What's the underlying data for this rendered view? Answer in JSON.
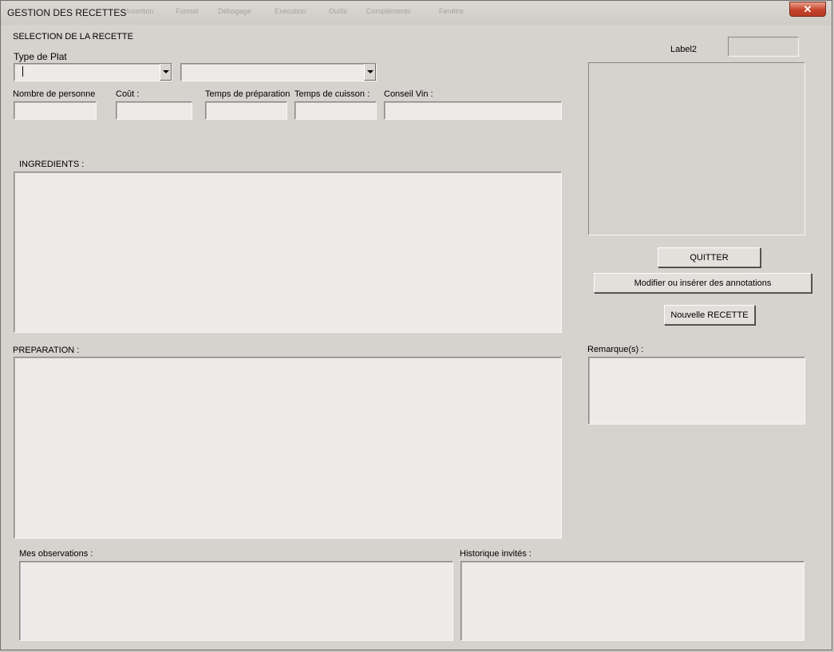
{
  "window": {
    "title": "GESTION DES RECETTES",
    "close_glyph": "✕"
  },
  "menu_ghost": [
    "Insertion",
    "Format",
    "Débogage",
    "Exécution",
    "Outils",
    "Compléments",
    "Fenêtre"
  ],
  "form": {
    "section_label": "SELECTION DE LA RECETTE",
    "type_plat_label": "Type de Plat",
    "type_plat_value": "",
    "recette_value": "",
    "nb_personne_label": "Nombre de personne",
    "cout_label": "Coût :",
    "temps_prep_label": "Temps de préparation",
    "temps_cuisson_label": "Temps de cuisson :",
    "conseil_vin_label": "Conseil Vin :",
    "nb_personne_value": "",
    "cout_value": "",
    "temps_prep_value": "",
    "temps_cuisson_value": "",
    "conseil_vin_value": "",
    "ingredients_label": "INGREDIENTS :",
    "preparation_label": "PREPARATION :",
    "remarques_label": "Remarque(s) :",
    "observations_label": "Mes observations :",
    "historique_label": "Historique invités :",
    "label2": "Label2"
  },
  "buttons": {
    "quit": "QUITTER",
    "annotations": "Modifier ou insérer des annotations",
    "new_recipe": "Nouvelle RECETTE"
  }
}
